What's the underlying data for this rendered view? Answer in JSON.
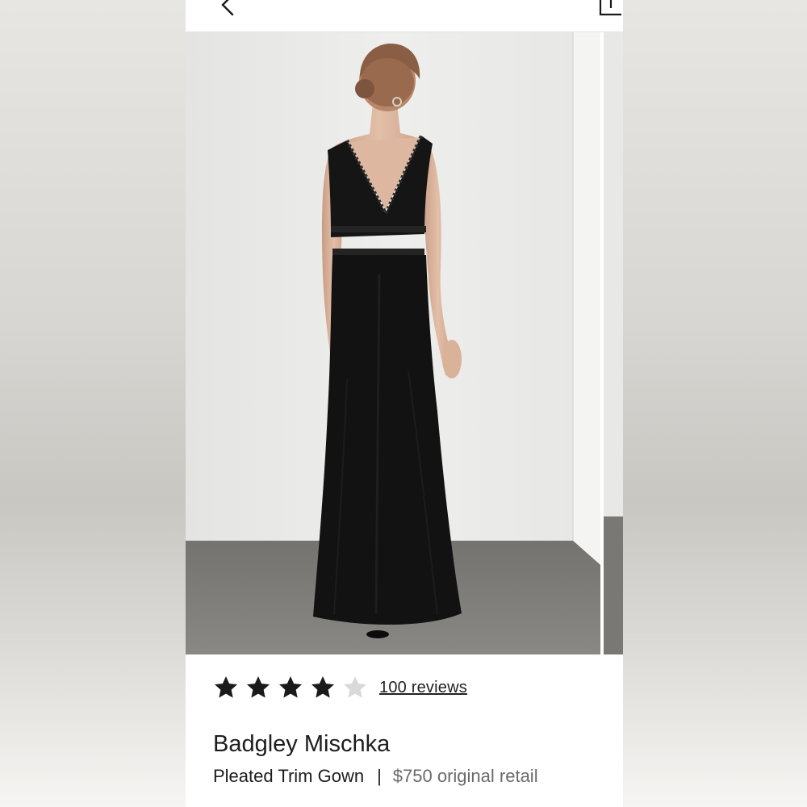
{
  "product": {
    "rating": 4,
    "rating_max": 5,
    "reviews_label": "100 reviews",
    "brand": "Badgley Mischka",
    "name": "Pleated Trim Gown",
    "separator": "|",
    "price_text": "$750 original retail"
  },
  "icons": {
    "back": "chevron-left-icon",
    "share": "share-icon",
    "star_filled": "star-filled-icon",
    "star_empty": "star-empty-icon"
  },
  "colors": {
    "star_filled": "#1a1a1a",
    "star_empty": "#d9d9d9",
    "dress": "#121212",
    "wall": "#ebebea",
    "floor": "#7d7b77"
  }
}
